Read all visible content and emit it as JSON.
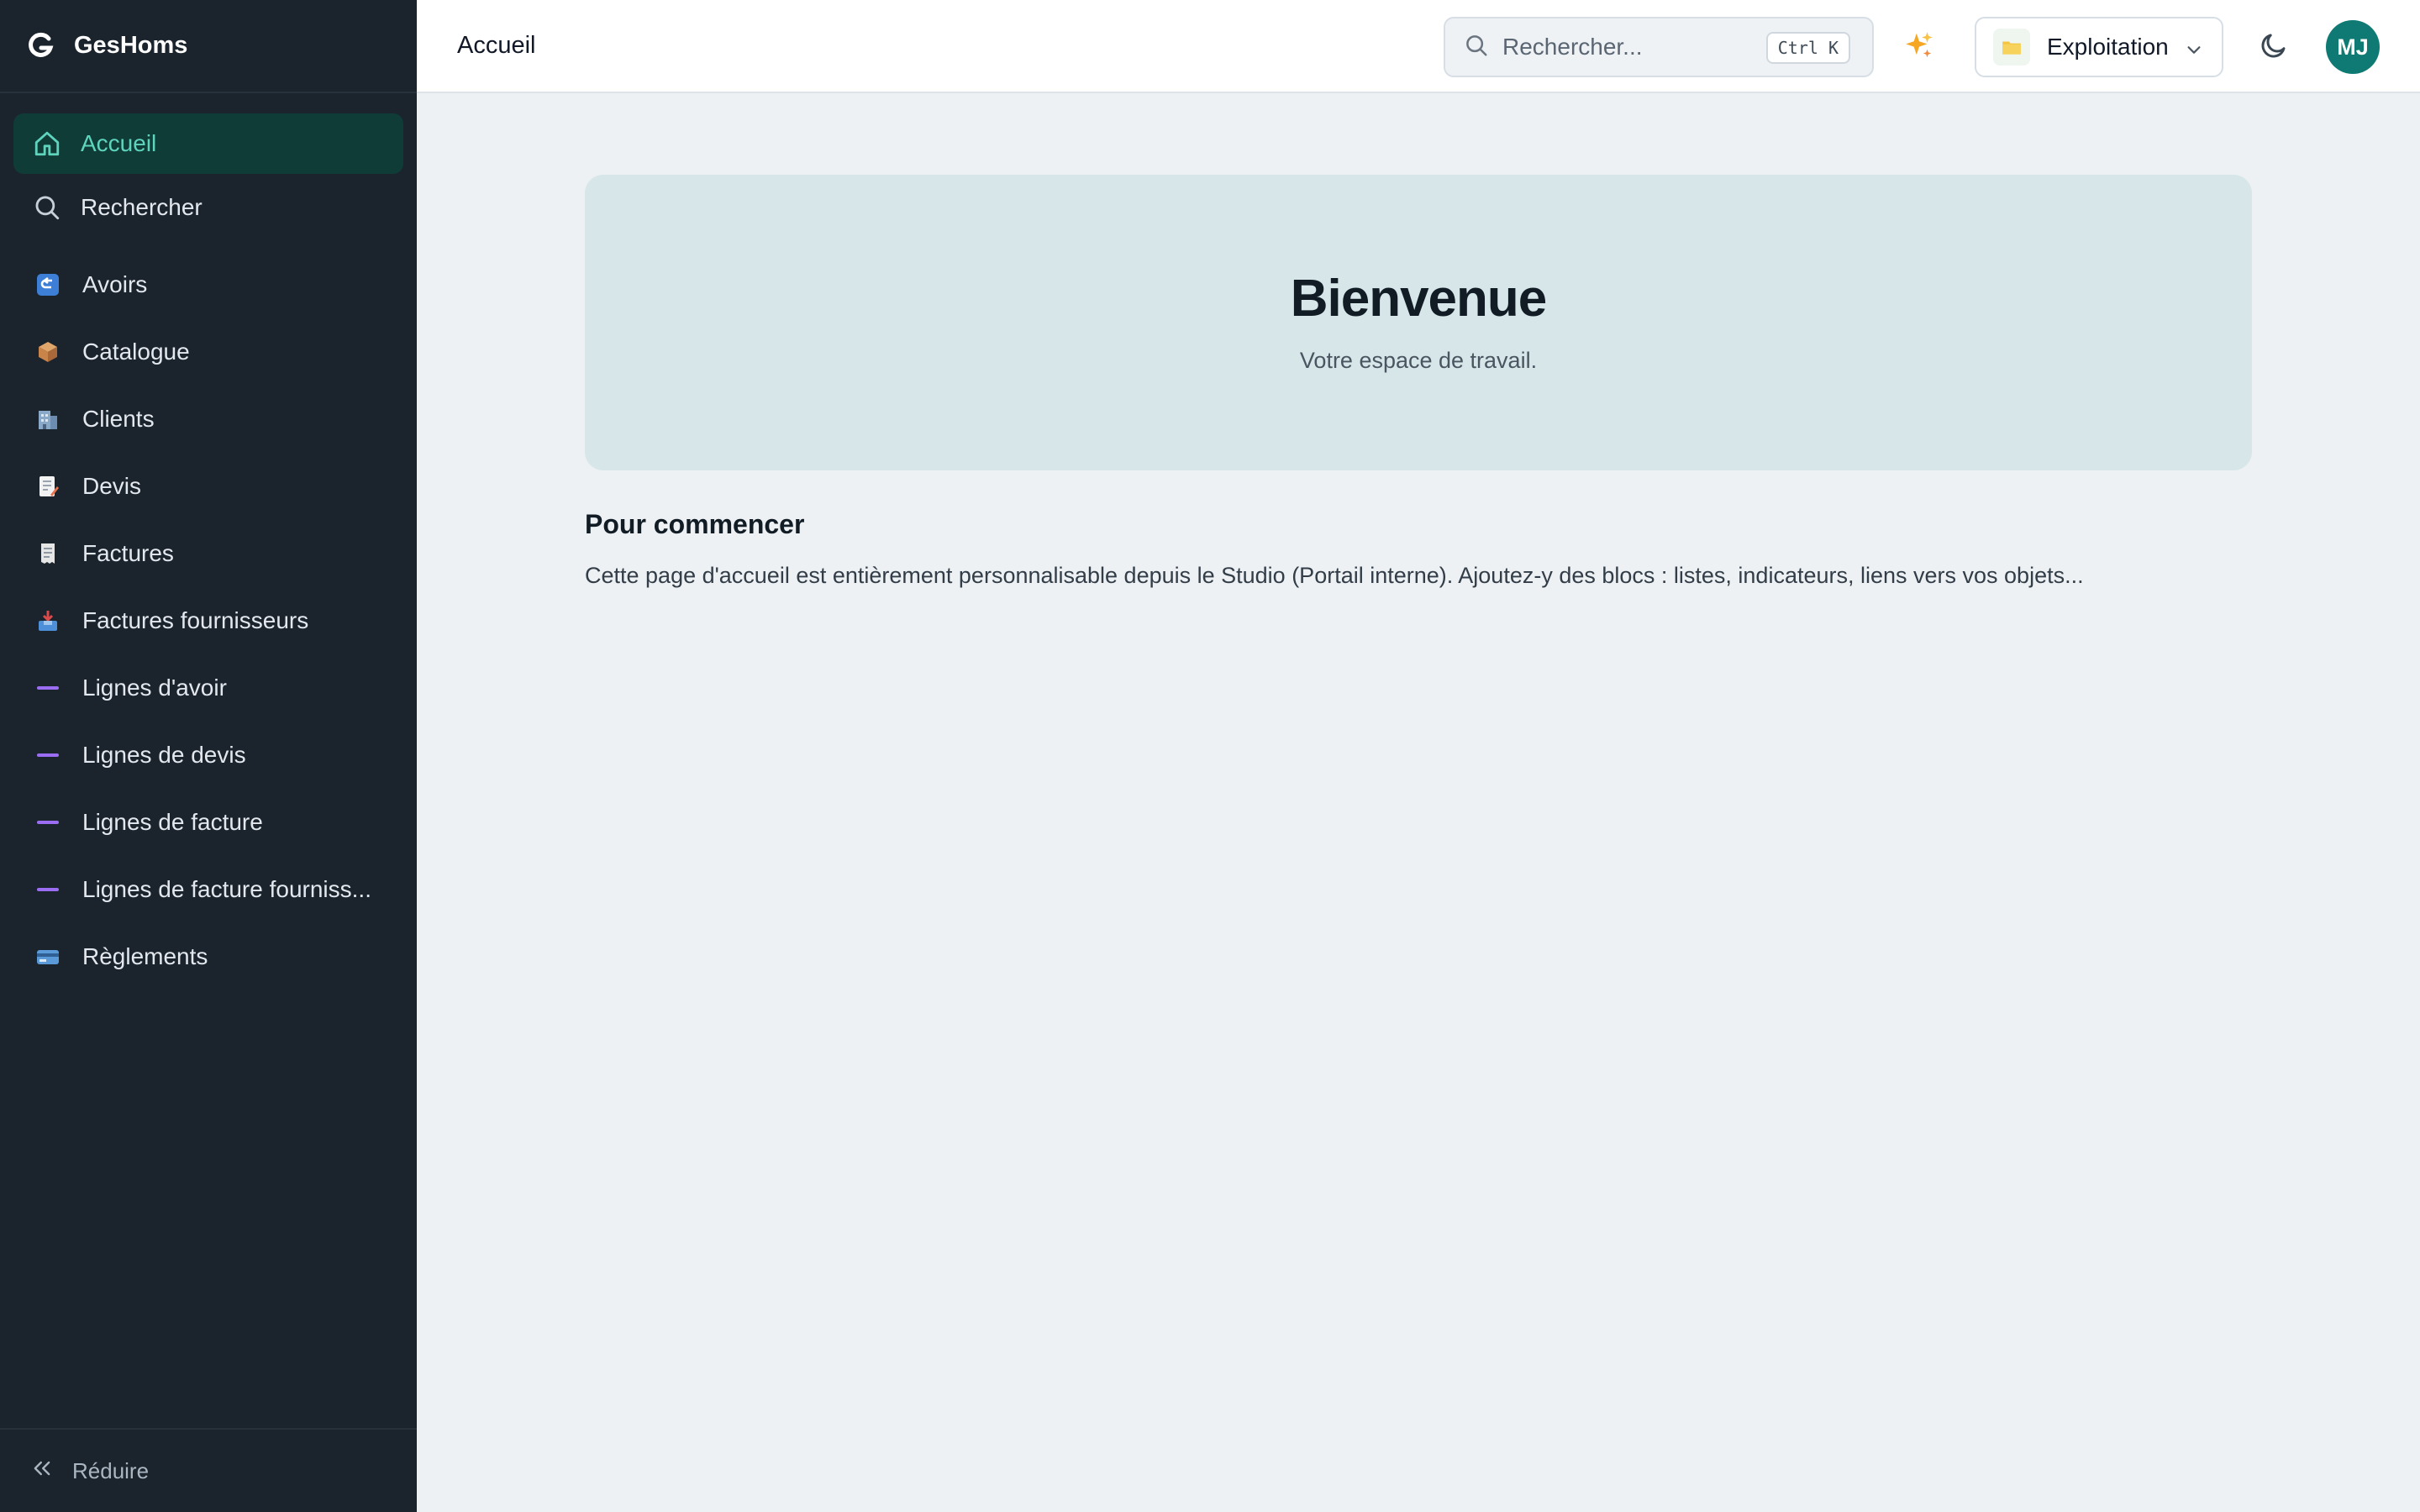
{
  "app": {
    "name": "GesHoms"
  },
  "sidebar": {
    "nav": [
      {
        "label": "Accueil",
        "icon": "home-icon",
        "active": true
      },
      {
        "label": "Rechercher",
        "icon": "search-icon",
        "active": false
      }
    ],
    "objects": [
      {
        "label": "Avoirs",
        "icon": "return-arrow-icon"
      },
      {
        "label": "Catalogue",
        "icon": "package-icon"
      },
      {
        "label": "Clients",
        "icon": "building-icon"
      },
      {
        "label": "Devis",
        "icon": "memo-icon"
      },
      {
        "label": "Factures",
        "icon": "receipt-icon"
      },
      {
        "label": "Factures fournisseurs",
        "icon": "inbox-tray-icon"
      },
      {
        "label": "Lignes d'avoir",
        "icon": "dash-line-icon"
      },
      {
        "label": "Lignes de devis",
        "icon": "dash-line-icon"
      },
      {
        "label": "Lignes de facture",
        "icon": "dash-line-icon"
      },
      {
        "label": "Lignes de facture fourniss...",
        "icon": "dash-line-icon"
      },
      {
        "label": "Règlements",
        "icon": "credit-card-icon"
      }
    ],
    "footer": {
      "label": "Réduire",
      "icon": "double-chevron-left-icon"
    }
  },
  "header": {
    "title": "Accueil",
    "search": {
      "placeholder": "Rechercher...",
      "shortcut": "Ctrl K"
    },
    "workspace": {
      "label": "Exploitation",
      "icon": "folder-icon"
    },
    "avatar": {
      "initials": "MJ"
    }
  },
  "main": {
    "hero": {
      "title": "Bienvenue",
      "subtitle": "Votre espace de travail."
    },
    "getting_started": {
      "title": "Pour commencer",
      "text": "Cette page d'accueil est entièrement personnalisable depuis le Studio (Portail interne). Ajoutez-y des blocs : listes, indicateurs, liens vers vos objets..."
    }
  },
  "colors": {
    "sidebar_bg": "#1b232c",
    "active_bg": "#103c38",
    "active_text": "#5fd4bd",
    "accent": "#0f7a73",
    "hero_bg": "#d6e6e9",
    "page_bg": "#edf1f4"
  }
}
